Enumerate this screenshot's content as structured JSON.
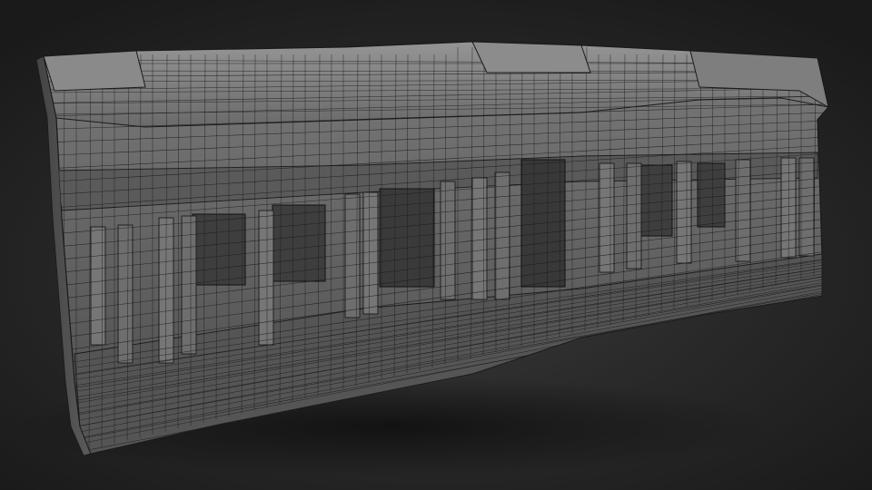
{
  "scene": {
    "subject": "wireframe-building-facade-render",
    "colors": {
      "background_center": "#3a3a3a",
      "background_edge": "#181818",
      "surface": "#6a6a6a",
      "wire": "#1a1a1a"
    }
  }
}
